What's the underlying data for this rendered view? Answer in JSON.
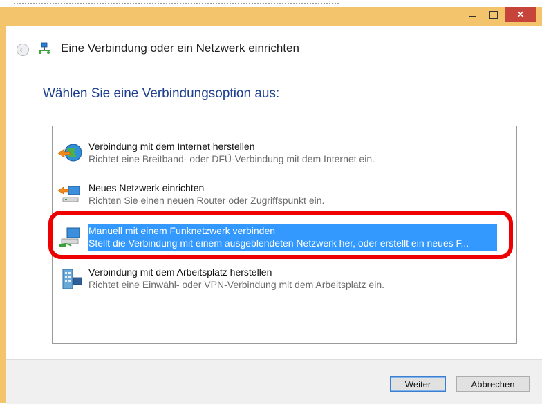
{
  "window": {
    "title": "Eine Verbindung oder ein Netzwerk einrichten",
    "controls": {
      "minimize": "minimize",
      "maximize": "maximize",
      "close": "✕"
    }
  },
  "nav": {
    "back_icon": "back-arrow-icon",
    "title": "Eine Verbindung oder ein Netzwerk einrichten"
  },
  "main": {
    "heading": "Wählen Sie eine Verbindungsoption aus:",
    "options": [
      {
        "title": "Verbindung mit dem Internet herstellen",
        "desc": "Richtet eine Breitband- oder DFÜ-Verbindung mit dem Internet ein.",
        "icon": "globe-network-icon",
        "selected": false
      },
      {
        "title": "Neues Netzwerk einrichten",
        "desc": "Richten Sie einen neuen Router oder Zugriffspunkt ein.",
        "icon": "router-icon",
        "selected": false
      },
      {
        "title": "Manuell mit einem Funknetzwerk verbinden",
        "desc": "Stellt die Verbindung mit einem ausgeblendeten Netzwerk her, oder erstellt ein neues F...",
        "icon": "wireless-network-icon",
        "selected": true
      },
      {
        "title": "Verbindung mit dem Arbeitsplatz herstellen",
        "desc": "Richtet eine Einwähl- oder VPN-Verbindung mit dem Arbeitsplatz ein.",
        "icon": "workplace-vpn-icon",
        "selected": false
      }
    ]
  },
  "footer": {
    "next_label": "Weiter",
    "cancel_label": "Abbrechen"
  },
  "colors": {
    "frame": "#f3c46b",
    "selection": "#3399ff",
    "heading": "#1e3f91",
    "highlight_ring": "#ee0000",
    "close_button": "#c7443a"
  }
}
